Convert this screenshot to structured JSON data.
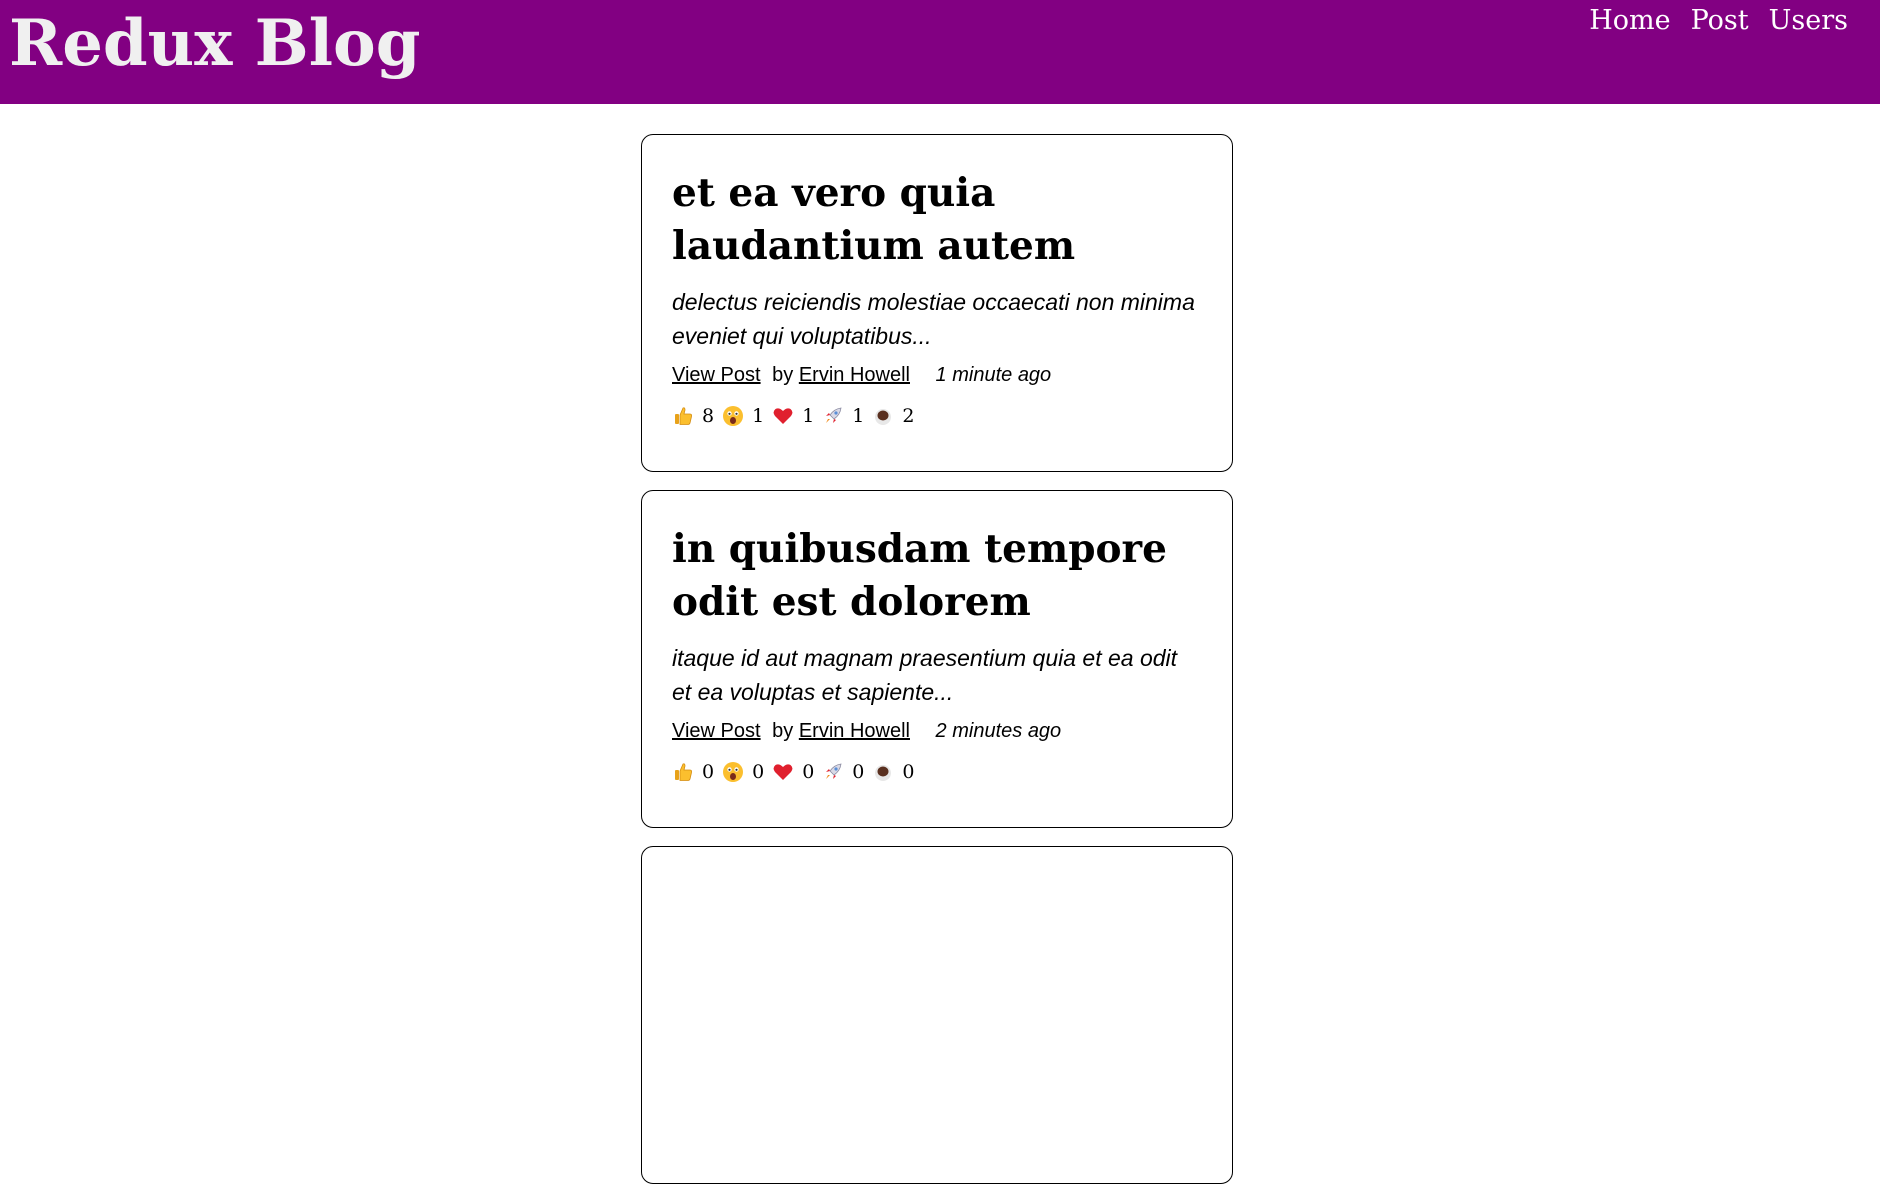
{
  "header": {
    "title": "Redux Blog",
    "nav": [
      "Home",
      "Post",
      "Users"
    ]
  },
  "posts": [
    {
      "title": "et ea vero quia laudantium autem",
      "excerpt": "delectus reiciendis molestiae occaecati non minima eveniet qui voluptatibus...",
      "view_label": "View Post",
      "by_label": "by",
      "author": "Ervin Howell",
      "time": "1 minute ago",
      "reactions": [
        {
          "icon": "thumbs-up",
          "count": "8"
        },
        {
          "icon": "wow",
          "count": "1"
        },
        {
          "icon": "heart",
          "count": "1"
        },
        {
          "icon": "rocket",
          "count": "1"
        },
        {
          "icon": "coffee",
          "count": "2"
        }
      ]
    },
    {
      "title": "in quibusdam tempore odit est dolorem",
      "excerpt": "itaque id aut magnam praesentium quia et ea odit et ea voluptas et sapiente...",
      "view_label": "View Post",
      "by_label": "by",
      "author": "Ervin Howell",
      "time": "2 minutes ago",
      "reactions": [
        {
          "icon": "thumbs-up",
          "count": "0"
        },
        {
          "icon": "wow",
          "count": "0"
        },
        {
          "icon": "heart",
          "count": "0"
        },
        {
          "icon": "rocket",
          "count": "0"
        },
        {
          "icon": "coffee",
          "count": "0"
        }
      ]
    }
  ],
  "colors": {
    "header_bg": "#820082",
    "header_text": "#ffffff"
  }
}
